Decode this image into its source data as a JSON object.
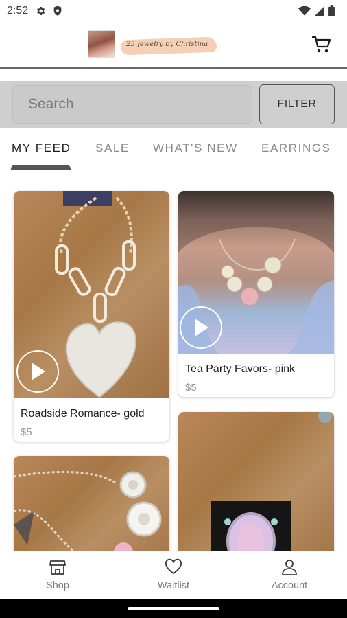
{
  "status_bar": {
    "time": "2:52",
    "left_icons": [
      "settings-gear-icon",
      "shield-icon"
    ],
    "right_icons": [
      "wifi-icon",
      "cell-signal-icon",
      "battery-icon"
    ]
  },
  "header": {
    "logo_text": "25 Jewelry by Christina",
    "cart_icon": "shopping-cart-icon"
  },
  "search": {
    "placeholder": "Search",
    "value": "",
    "filter_label": "FILTER"
  },
  "tabs": [
    {
      "label": "MY FEED",
      "active": true
    },
    {
      "label": "SALE",
      "active": false
    },
    {
      "label": "WHAT'S NEW",
      "active": false
    },
    {
      "label": "EARRINGS",
      "active": false
    }
  ],
  "products": [
    {
      "title": "Roadside Romance- gold",
      "price": "$5",
      "has_video": true
    },
    {
      "title": "Tea Party Favors- pink",
      "price": "$5",
      "has_video": true
    },
    {
      "title": "",
      "price": "",
      "has_video": false
    },
    {
      "title": "",
      "price": "",
      "has_video": false
    }
  ],
  "bottom_nav": [
    {
      "label": "Shop",
      "icon": "store-icon"
    },
    {
      "label": "Waitlist",
      "icon": "heart-icon"
    },
    {
      "label": "Account",
      "icon": "person-icon"
    }
  ]
}
